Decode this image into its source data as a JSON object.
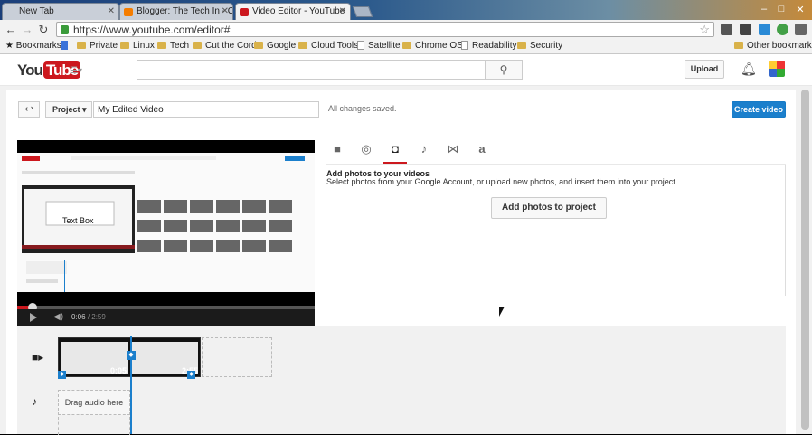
{
  "browser": {
    "tabs": [
      {
        "label": "New Tab"
      },
      {
        "label": "Blogger: The Tech In - Cr"
      },
      {
        "label": "Video Editor - YouTube"
      }
    ],
    "url": "https://www.youtube.com/editor#",
    "bookmarks": [
      {
        "label": "Bookmarks"
      },
      {
        "label": "Private"
      },
      {
        "label": "Linux"
      },
      {
        "label": "Tech"
      },
      {
        "label": "Cut the Cord"
      },
      {
        "label": "Google"
      },
      {
        "label": "Cloud Tools"
      },
      {
        "label": "Satellite"
      },
      {
        "label": "Chrome OS"
      },
      {
        "label": "Readability"
      },
      {
        "label": "Security"
      },
      {
        "label": "Other bookmarks"
      }
    ],
    "window_controls": [
      "–",
      "□",
      "✕"
    ]
  },
  "youtube": {
    "logo_you": "You",
    "logo_tube": "Tube",
    "upload_label": "Upload",
    "search_placeholder": ""
  },
  "editor": {
    "back_label": "↩",
    "project_label": "Project ▾",
    "title_value": "My Edited Video",
    "status": "All changes saved.",
    "create_label": "Create video",
    "preview_text": "Text Box",
    "time_current": "0:06",
    "time_total": "/ 2:59",
    "progress_fraction": 0.034,
    "panel_tabs": [
      {
        "icon": "video-camera-icon",
        "glyph": "■"
      },
      {
        "icon": "cc-icon",
        "glyph": "◎"
      },
      {
        "icon": "camera-icon",
        "glyph": "◘"
      },
      {
        "icon": "music-note-icon",
        "glyph": "♪"
      },
      {
        "icon": "transitions-icon",
        "glyph": "⋈"
      },
      {
        "icon": "text-icon",
        "glyph": "a"
      }
    ],
    "selected_tab": 2,
    "panel_heading": "Add photos to your videos",
    "panel_text": "Select photos from your Google Account, or upload new photos, and insert them into your project.",
    "add_photos_label": "Add photos to project",
    "clip_time_1": "0:05",
    "clip_time_2": "2:55",
    "audio_placeholder": "Drag audio here"
  },
  "colors": {
    "accent": "#1b7fcc",
    "brand_red": "#cc181e"
  }
}
